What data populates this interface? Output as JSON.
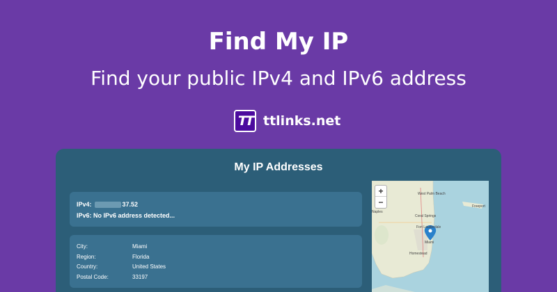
{
  "header": {
    "title": "Find My IP",
    "subtitle": "Find your public IPv4 and IPv6 address",
    "brand_logo": "TT",
    "brand_name": "ttlinks.net"
  },
  "card": {
    "title": "My IP Addresses",
    "ipv4_label": "IPv4:",
    "ipv4_value": "37.52",
    "ipv6_text": "IPv6: No IPv6 address detected...",
    "geo": [
      {
        "key": "City:",
        "value": "Miami"
      },
      {
        "key": "Region:",
        "value": "Florida"
      },
      {
        "key": "Country:",
        "value": "United States"
      },
      {
        "key": "Postal Code:",
        "value": "33197"
      }
    ]
  },
  "map": {
    "zoom_in": "+",
    "zoom_out": "−",
    "labels": {
      "palm_beach": "West Palm Beach",
      "coral_springs": "Coral Springs",
      "fort_lauderdale": "Fort Lauderdale",
      "miami": "Miami",
      "homestead": "Homestead",
      "freeport": "Freeport",
      "naples": "Naples"
    },
    "colors": {
      "water": "#aad3df",
      "land": "#e8ead5",
      "marker": "#2a81cb"
    }
  }
}
